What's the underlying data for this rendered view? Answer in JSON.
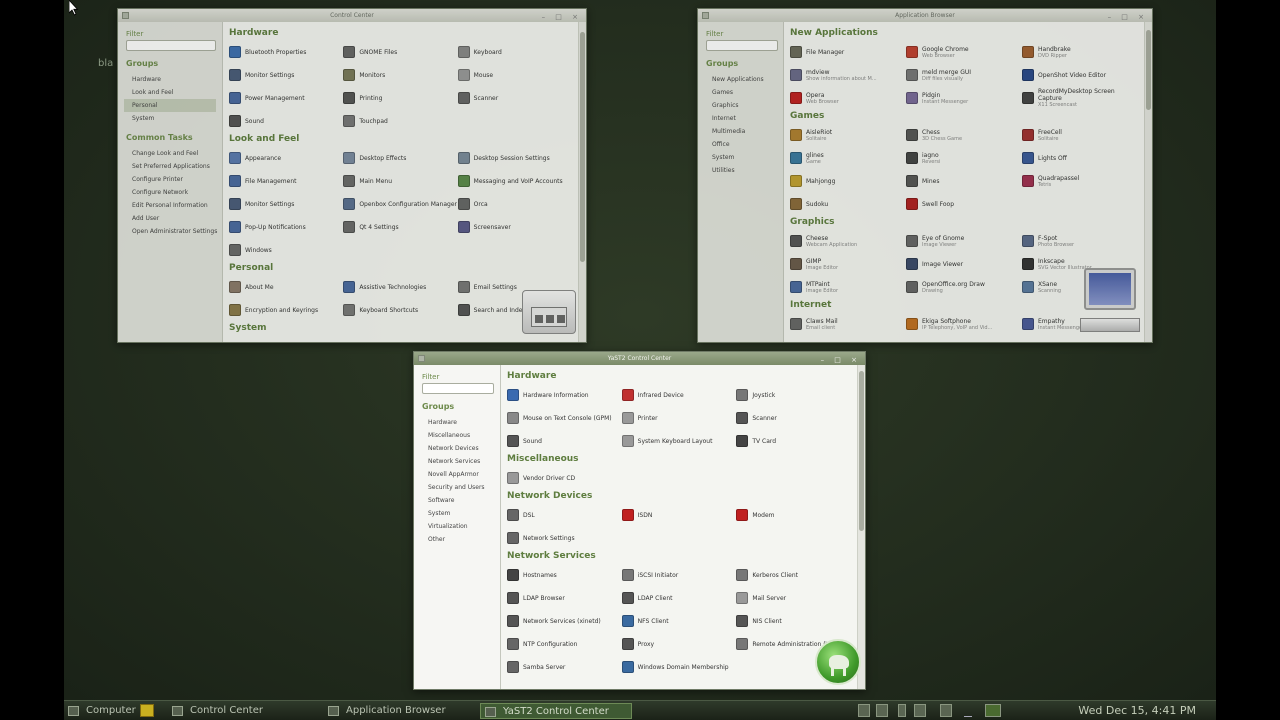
{
  "desktop": {
    "stray_text": "bla"
  },
  "cc": {
    "title": "Control Center",
    "filter_label": "Filter",
    "groups_label": "Groups",
    "groups": [
      "Hardware",
      "Look and Feel",
      "Personal",
      "System"
    ],
    "tasks_label": "Common Tasks",
    "tasks": [
      "Change Look and Feel",
      "Set Preferred Applications",
      "Configure Printer",
      "Configure Network",
      "Edit Personal Information",
      "Add User",
      "Open Administrator Settings"
    ],
    "sections": [
      {
        "name": "Hardware",
        "items": [
          {
            "label": "Bluetooth Properties",
            "icon": "bluetooth-icon",
            "color": "#3d6fb0"
          },
          {
            "label": "GNOME Files",
            "icon": "files-icon",
            "color": "#666"
          },
          {
            "label": "Keyboard",
            "icon": "keyboard-icon",
            "color": "#888"
          },
          {
            "label": "Monitor Settings",
            "icon": "monitor-icon",
            "color": "#4a5c7a"
          },
          {
            "label": "Monitors",
            "icon": "monitors-icon",
            "color": "#7a7a5a"
          },
          {
            "label": "Mouse",
            "icon": "mouse-icon",
            "color": "#999"
          },
          {
            "label": "Power Management",
            "icon": "power-icon",
            "color": "#4a6aa0"
          },
          {
            "label": "Printing",
            "icon": "printer-icon",
            "color": "#555"
          },
          {
            "label": "Scanner",
            "icon": "scanner-icon",
            "color": "#666"
          },
          {
            "label": "Sound",
            "icon": "sound-icon",
            "color": "#555"
          },
          {
            "label": "Touchpad",
            "icon": "touchpad-icon",
            "color": "#777"
          }
        ]
      },
      {
        "name": "Look and Feel",
        "items": [
          {
            "label": "Appearance",
            "icon": "appearance-icon",
            "color": "#5a7ab0"
          },
          {
            "label": "Desktop Effects",
            "icon": "effects-icon",
            "color": "#7a8aa0"
          },
          {
            "label": "Desktop Session Settings",
            "icon": "session-icon",
            "color": "#7a8a9a"
          },
          {
            "label": "File Management",
            "icon": "file-mgmt-icon",
            "color": "#4a6aa0"
          },
          {
            "label": "Main Menu",
            "icon": "menu-icon",
            "color": "#6a6a6a"
          },
          {
            "label": "Messaging and VoIP Accounts",
            "icon": "messaging-icon",
            "color": "#5a8a4a"
          },
          {
            "label": "Monitor Settings",
            "icon": "monitor-icon",
            "color": "#4a5c7a"
          },
          {
            "label": "Openbox Configuration Manager",
            "icon": "openbox-icon",
            "color": "#5a7090"
          },
          {
            "label": "Orca",
            "icon": "orca-icon",
            "color": "#666"
          },
          {
            "label": "Pop-Up Notifications",
            "icon": "notify-icon",
            "color": "#4a6aa0"
          },
          {
            "label": "Qt 4 Settings",
            "icon": "qt-icon",
            "color": "#6a6a6a"
          },
          {
            "label": "Screensaver",
            "icon": "screensaver-icon",
            "color": "#5a5a8a"
          },
          {
            "label": "Windows",
            "icon": "windows-icon",
            "color": "#6a6a6a"
          }
        ]
      },
      {
        "name": "Personal",
        "items": [
          {
            "label": "About Me",
            "icon": "about-me-icon",
            "color": "#8a7a6a"
          },
          {
            "label": "Assistive Technologies",
            "icon": "assistive-icon",
            "color": "#4a6aa0"
          },
          {
            "label": "Email Settings",
            "icon": "email-icon",
            "color": "#777"
          },
          {
            "label": "Encryption and Keyrings",
            "icon": "keyring-icon",
            "color": "#8a7a4a"
          },
          {
            "label": "Keyboard Shortcuts",
            "icon": "shortcuts-icon",
            "color": "#777"
          },
          {
            "label": "Search and Indexing",
            "icon": "search-index-icon",
            "color": "#555"
          }
        ]
      },
      {
        "name": "System",
        "items": []
      }
    ]
  },
  "ab": {
    "title": "Application Browser",
    "filter_label": "Filter",
    "groups_label": "Groups",
    "groups": [
      "New Applications",
      "Games",
      "Graphics",
      "Internet",
      "Multimedia",
      "Office",
      "System",
      "Utilities"
    ],
    "sections": [
      {
        "name": "New Applications",
        "items": [
          {
            "label": "File Manager",
            "sub": "",
            "icon": "file-manager-icon",
            "color": "#6a6a5a"
          },
          {
            "label": "Google Chrome",
            "sub": "Web Browser",
            "icon": "chrome-icon",
            "color": "#c04030"
          },
          {
            "label": "Handbrake",
            "sub": "DVD Ripper",
            "icon": "handbrake-icon",
            "color": "#a06030"
          },
          {
            "label": "mdview",
            "sub": "Show information about M...",
            "icon": "mdview-icon",
            "color": "#6a6a8a"
          },
          {
            "label": "meld merge GUI",
            "sub": "Diff files visually",
            "icon": "meld-icon",
            "color": "#777"
          },
          {
            "label": "OpenShot Video Editor",
            "sub": "",
            "icon": "openshot-icon",
            "color": "#2a4a8a"
          },
          {
            "label": "Opera",
            "sub": "Web Browser",
            "icon": "opera-icon",
            "color": "#c02020"
          },
          {
            "label": "Pidgin",
            "sub": "Instant Messenger",
            "icon": "pidgin-icon",
            "color": "#7a6a9a"
          },
          {
            "label": "RecordMyDesktop Screen Capture",
            "sub": "X11 Screencast",
            "icon": "recorder-icon",
            "color": "#444"
          }
        ]
      },
      {
        "name": "Games",
        "items": [
          {
            "label": "AisleRiot",
            "sub": "Solitaire",
            "icon": "aisleriot-icon",
            "color": "#b08030"
          },
          {
            "label": "Chess",
            "sub": "3D Chess Game",
            "icon": "chess-icon",
            "color": "#555"
          },
          {
            "label": "FreeCell",
            "sub": "Solitaire",
            "icon": "freecell-icon",
            "color": "#a03030"
          },
          {
            "label": "glines",
            "sub": "Game",
            "icon": "glines-icon",
            "color": "#3a7aa0"
          },
          {
            "label": "iagno",
            "sub": "Reversi",
            "icon": "iagno-icon",
            "color": "#444"
          },
          {
            "label": "Lights Off",
            "sub": "",
            "icon": "lightsoff-icon",
            "color": "#3a5a9a"
          },
          {
            "label": "Mahjongg",
            "sub": "",
            "icon": "mahjongg-icon",
            "color": "#c0a030"
          },
          {
            "label": "Mines",
            "sub": "",
            "icon": "mines-icon",
            "color": "#555"
          },
          {
            "label": "Quadrapassel",
            "sub": "Tetris",
            "icon": "quadrapassel-icon",
            "color": "#a03050"
          },
          {
            "label": "Sudoku",
            "sub": "",
            "icon": "sudoku-icon",
            "color": "#8a6a3a"
          },
          {
            "label": "Swell Foop",
            "sub": "",
            "icon": "swellfoop-icon",
            "color": "#b02020"
          }
        ]
      },
      {
        "name": "Graphics",
        "items": [
          {
            "label": "Cheese",
            "sub": "Webcam Application",
            "icon": "cheese-icon",
            "color": "#555"
          },
          {
            "label": "Eye of Gnome",
            "sub": "Image Viewer",
            "icon": "eog-icon",
            "color": "#666"
          },
          {
            "label": "F-Spot",
            "sub": "Photo Browser",
            "icon": "fspot-icon",
            "color": "#5a6a8a"
          },
          {
            "label": "GIMP",
            "sub": "Image Editor",
            "icon": "gimp-icon",
            "color": "#6a5a4a"
          },
          {
            "label": "Image Viewer",
            "sub": "",
            "icon": "image-viewer-icon",
            "color": "#3a4a6a"
          },
          {
            "label": "Inkscape",
            "sub": "SVG Vector Illustrator",
            "icon": "inkscape-icon",
            "color": "#333"
          },
          {
            "label": "MTPaint",
            "sub": "Image Editor",
            "icon": "mtpaint-icon",
            "color": "#4a6aa0"
          },
          {
            "label": "OpenOffice.org Draw",
            "sub": "Drawing",
            "icon": "oodraw-icon",
            "color": "#666"
          },
          {
            "label": "XSane",
            "sub": "Scanning",
            "icon": "xsane-icon",
            "color": "#5a7aa0"
          }
        ]
      },
      {
        "name": "Internet",
        "items": [
          {
            "label": "Claws Mail",
            "sub": "Email client",
            "icon": "claws-icon",
            "color": "#666"
          },
          {
            "label": "Ekiga Softphone",
            "sub": "IP Telephony, VoIP and Vid...",
            "icon": "ekiga-icon",
            "color": "#c07020"
          },
          {
            "label": "Empathy",
            "sub": "Instant Messenger",
            "icon": "empathy-icon",
            "color": "#4a5a9a"
          }
        ]
      }
    ]
  },
  "yast": {
    "title": "YaST2 Control Center",
    "filter_label": "Filter",
    "groups_label": "Groups",
    "groups": [
      "Hardware",
      "Miscellaneous",
      "Network Devices",
      "Network Services",
      "Novell AppArmor",
      "Security and Users",
      "Software",
      "System",
      "Virtualization",
      "Other"
    ],
    "sections": [
      {
        "name": "Hardware",
        "items": [
          {
            "label": "Hardware Information",
            "icon": "info-icon",
            "color": "#3a6ab0"
          },
          {
            "label": "Infrared Device",
            "icon": "infrared-icon",
            "color": "#c03030"
          },
          {
            "label": "Joystick",
            "icon": "joystick-icon",
            "color": "#777"
          },
          {
            "label": "Mouse on Text Console (GPM)",
            "icon": "mouse-icon",
            "color": "#888"
          },
          {
            "label": "Printer",
            "icon": "printer-icon",
            "color": "#999"
          },
          {
            "label": "Scanner",
            "icon": "scanner-icon",
            "color": "#555"
          },
          {
            "label": "Sound",
            "icon": "sound-icon",
            "color": "#555"
          },
          {
            "label": "System Keyboard Layout",
            "icon": "keyboard-icon",
            "color": "#999"
          },
          {
            "label": "TV Card",
            "icon": "tv-icon",
            "color": "#444"
          }
        ]
      },
      {
        "name": "Miscellaneous",
        "items": [
          {
            "label": "Vendor Driver CD",
            "icon": "cd-icon",
            "color": "#999"
          }
        ]
      },
      {
        "name": "Network Devices",
        "items": [
          {
            "label": "DSL",
            "icon": "dsl-icon",
            "color": "#666"
          },
          {
            "label": "ISDN",
            "icon": "isdn-icon",
            "color": "#c02020"
          },
          {
            "label": "Modem",
            "icon": "modem-icon",
            "color": "#c02020"
          },
          {
            "label": "Network Settings",
            "icon": "network-icon",
            "color": "#666"
          }
        ]
      },
      {
        "name": "Network Services",
        "items": [
          {
            "label": "Hostnames",
            "icon": "hostnames-icon",
            "color": "#444"
          },
          {
            "label": "iSCSI Initiator",
            "icon": "iscsi-icon",
            "color": "#777"
          },
          {
            "label": "Kerberos Client",
            "icon": "kerberos-icon",
            "color": "#777"
          },
          {
            "label": "LDAP Browser",
            "icon": "ldap-browser-icon",
            "color": "#555"
          },
          {
            "label": "LDAP Client",
            "icon": "ldap-client-icon",
            "color": "#555"
          },
          {
            "label": "Mail Server",
            "icon": "mail-icon",
            "color": "#999"
          },
          {
            "label": "Network Services (xinetd)",
            "icon": "xinetd-icon",
            "color": "#555"
          },
          {
            "label": "NFS Client",
            "icon": "nfs-client-icon",
            "color": "#3a6aa0"
          },
          {
            "label": "NIS Client",
            "icon": "nis-client-icon",
            "color": "#555"
          },
          {
            "label": "NTP Configuration",
            "icon": "ntp-icon",
            "color": "#666"
          },
          {
            "label": "Proxy",
            "icon": "proxy-icon",
            "color": "#555"
          },
          {
            "label": "Remote Administration (VNC)",
            "icon": "vnc-icon",
            "color": "#777"
          },
          {
            "label": "Samba Server",
            "icon": "samba-icon",
            "color": "#666"
          },
          {
            "label": "Windows Domain Membership",
            "icon": "windows-domain-icon",
            "color": "#3a6aa0"
          }
        ]
      }
    ]
  },
  "taskbar": {
    "items": [
      "Computer",
      "Control Center",
      "Application Browser",
      "YaST2 Control Center"
    ],
    "clock": "Wed Dec 15,  4:41 PM"
  }
}
